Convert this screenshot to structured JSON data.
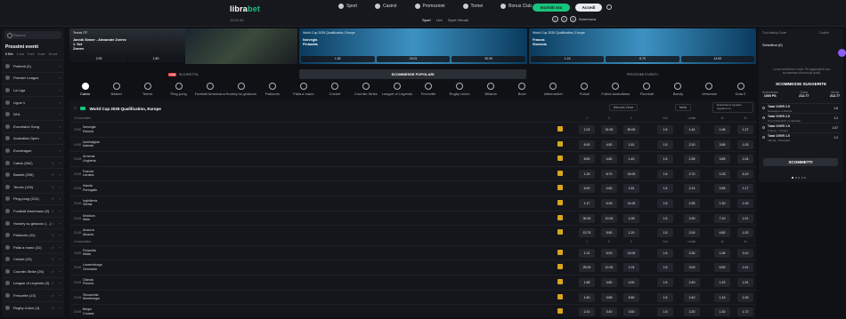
{
  "header": {
    "logo_a": "libra",
    "logo_b": "bet",
    "datetime": "12:21:42",
    "nav": [
      "Sport",
      "Casinò",
      "Promozioni",
      "Tornei",
      "Bonus Club"
    ],
    "register_label": "Iscriviti ora",
    "login_label": "Accedi",
    "subnav": [
      "Sport",
      "Live",
      "Sport Virtuali"
    ],
    "odds_format_label": "Americana"
  },
  "sidebar": {
    "search_placeholder": "Ricerca",
    "title": "Prossimi eventi",
    "days": [
      "5 Min",
      "1 ora",
      "3 ore",
      "6 ore",
      "24 ore"
    ],
    "items": [
      {
        "label": "Preferiti (0)"
      },
      {
        "label": "Premier League"
      },
      {
        "label": "La Liga"
      },
      {
        "label": "Ligue 1"
      },
      {
        "label": "NHL"
      },
      {
        "label": "Eurovisión Song"
      },
      {
        "label": "Australian Open"
      },
      {
        "label": "Euroleague"
      },
      {
        "label": "Calcio (562)"
      },
      {
        "label": "Basket (296)"
      },
      {
        "label": "Tennis (125)"
      },
      {
        "label": "Ping-pong (213)"
      },
      {
        "label": "Football Americano (0)"
      },
      {
        "label": "Hockey su ghiaccio (…)"
      },
      {
        "label": "Pallavolo (41)"
      },
      {
        "label": "Palla a mano (31)"
      },
      {
        "label": "Cricket (23)"
      },
      {
        "label": "Counter-Strike (26)"
      },
      {
        "label": "League of Legends (0)"
      },
      {
        "label": "Freccette (13)"
      },
      {
        "label": "Rugby Union (4)"
      }
    ]
  },
  "banners": [
    {
      "title": "Tennis ITF",
      "teams": [
        "Jannik Sinner - Alexander Zverev",
        "1. Set",
        "Zverev"
      ],
      "odds": [
        "2.05",
        "1.80"
      ]
    },
    {
      "title": "World Cup 2026 Qualification, Europe",
      "teams": [
        "Norvegia",
        "Finlandia"
      ],
      "odds": [
        "1.82",
        "23.01",
        "30.00"
      ]
    },
    {
      "title": "World Cup 2026 Qualification, Europe",
      "teams": [
        "Francia",
        "Slovenia"
      ],
      "odds": [
        "1.24",
        "6.70",
        "13.00"
      ]
    }
  ],
  "tabs": {
    "live_badge": "LIVE",
    "items": [
      "IN DIRETTA",
      "SCOMMESSE POPOLARI",
      "PROSSIMI EVENTI"
    ]
  },
  "sports": [
    "Calcio",
    "Basket",
    "Tennis",
    "Ping-pong",
    "Football Americano",
    "Hockey su ghiaccio",
    "Pallavolo",
    "Palla a mano",
    "Cricket",
    "Counter-Strike",
    "League of Legends",
    "Freccette",
    "Rugby Union",
    "Biliardo",
    "Boxe",
    "Aftermarket",
    "Futsal",
    "Futbol australiano",
    "Floorball",
    "Bandy",
    "Vetroriani",
    "Dota 2"
  ],
  "main": {
    "title": "World Cup 2026 Qualification, Europe",
    "market_select": "Mercato Vince",
    "half_select": "Metà",
    "result_select": "Entramba le squadre segnano no",
    "col_labels": [
      "1",
      "X",
      "2",
      "Gol",
      "Under",
      "1x",
      "2x"
    ],
    "section1": "13 novembre",
    "section2": "14 novembre",
    "matches": [
      {
        "time": "19:00",
        "home": "Norvegia",
        "away": "Estonia",
        "odds": [
          "1.02",
          "21.00",
          "50.00",
          "1.5",
          "1.44",
          "1.06",
          "1.27"
        ]
      },
      {
        "time": "19:00",
        "home": "Azerbaigian",
        "away": "Islanda",
        "odds": [
          "6.00",
          "4.50",
          "1.51",
          "1.5",
          "2.20",
          "3.65",
          "1.03"
        ]
      },
      {
        "time": "20:45",
        "home": "Armenia",
        "away": "Ungheria",
        "odds": [
          "8.50",
          "4.80",
          "1.40",
          "1.5",
          "2.28",
          "3.85",
          "1.04"
        ]
      },
      {
        "time": "20:45",
        "home": "Francia",
        "away": "Ucraina",
        "odds": [
          "1.15",
          "6.70",
          "15.00",
          "1.5",
          "2.70",
          "1.03",
          "6.13"
        ]
      },
      {
        "time": "20:45",
        "home": "Irlanda",
        "away": "Portogallo",
        "odds": [
          "6.00",
          "4.60",
          "1.51",
          "1.5",
          "2.14",
          "2.65",
          "1.17"
        ]
      },
      {
        "time": "20:45",
        "home": "Inghilterra",
        "away": "Serbia",
        "odds": [
          "1.17",
          "6.25",
          "14.00",
          "1.5",
          "2.25",
          "1.30",
          "1.03"
        ]
      },
      {
        "time": "20:45",
        "home": "Moldova",
        "away": "Italia",
        "odds": [
          "30.00",
          "10.00",
          "1.05",
          "1.5",
          "3.30",
          "7.10",
          "1.01"
        ]
      },
      {
        "time": "20:45",
        "home": "Andorra",
        "away": "Albania",
        "odds": [
          "13.75",
          "5.50",
          "1.20",
          "1.5",
          "2.00",
          "4.80",
          "1.02"
        ]
      },
      {
        "time": "19:00",
        "home": "Finlandia",
        "away": "Malta",
        "odds": [
          "1.21",
          "6.00",
          "13.00",
          "1.5",
          "2.30",
          "1.06",
          "3.10"
        ]
      },
      {
        "time": "20:45",
        "home": "Lussemburgo",
        "away": "Germania",
        "odds": [
          "25.00",
          "12.00",
          "1.04",
          "1.5",
          "3.00",
          "6.50",
          "1.01"
        ]
      },
      {
        "time": "20:45",
        "home": "Olanda",
        "away": "Polonia",
        "odds": [
          "1.85",
          "3.80",
          "4.00",
          "1.5",
          "2.40",
          "1.23",
          "1.91"
        ]
      },
      {
        "time": "20:45",
        "home": "Slovacchia",
        "away": "Montenegro",
        "odds": [
          "1.60",
          "3.85",
          "5.50",
          "1.5",
          "2.40",
          "1.15",
          "2.15"
        ]
      },
      {
        "time": "20:45",
        "home": "Belgio",
        "away": "Croazia",
        "odds": [
          "2.10",
          "3.40",
          "3.50",
          "1.5",
          "2.20",
          "1.30",
          "1.72"
        ]
      }
    ]
  },
  "betslip": {
    "tabs": [
      "Tuoi betslip Code",
      "Codice"
    ],
    "sub": "Schedina (0)",
    "help": "La tua schedina è vuota. Per aggiungere una scommessa clicca sulla quota",
    "suggested_title": "SCOMMESSE SUGGERITE",
    "stats": [
      {
        "label": "Scommesse",
        "value": "1000 PS"
      },
      {
        "label": "Quota",
        "value": "212.77"
      },
      {
        "label": "Vincita",
        "value": "212.77"
      }
    ],
    "items": [
      {
        "name": "Total OVER 2.5",
        "desc": "Nicaragua vs Bolivia",
        "value": "1.6"
      },
      {
        "name": "Total OVER 2.5",
        "desc": "Czech Republic vs Gibraltar",
        "value": "1.2"
      },
      {
        "name": "Total OVER 1.5",
        "desc": "Francia - Ucraina",
        "value": "1.07"
      },
      {
        "name": "Total OVER 1.5",
        "desc": "Irlanda - Portogallo",
        "value": "1.2"
      }
    ],
    "bet_button": "SCOMMETTI"
  }
}
